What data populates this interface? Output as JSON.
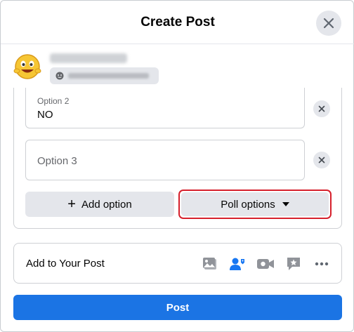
{
  "dialog": {
    "title": "Create Post",
    "close_icon": "close-icon"
  },
  "user": {
    "avatar_icon": "emoji-avatar"
  },
  "poll": {
    "option2": {
      "label": "Option 2",
      "value": "NO"
    },
    "option3": {
      "placeholder": "Option 3"
    },
    "add_option_label": "Add option",
    "add_option_icon": "+",
    "poll_options_label": "Poll options",
    "highlight_color": "#d6202c"
  },
  "add_to_post": {
    "label": "Add to Your Post",
    "icons": [
      "photo-icon",
      "tag-people-icon",
      "live-video-icon",
      "feeling-icon",
      "more-icon"
    ]
  },
  "post_button": {
    "label": "Post",
    "color": "#1b74e4"
  }
}
